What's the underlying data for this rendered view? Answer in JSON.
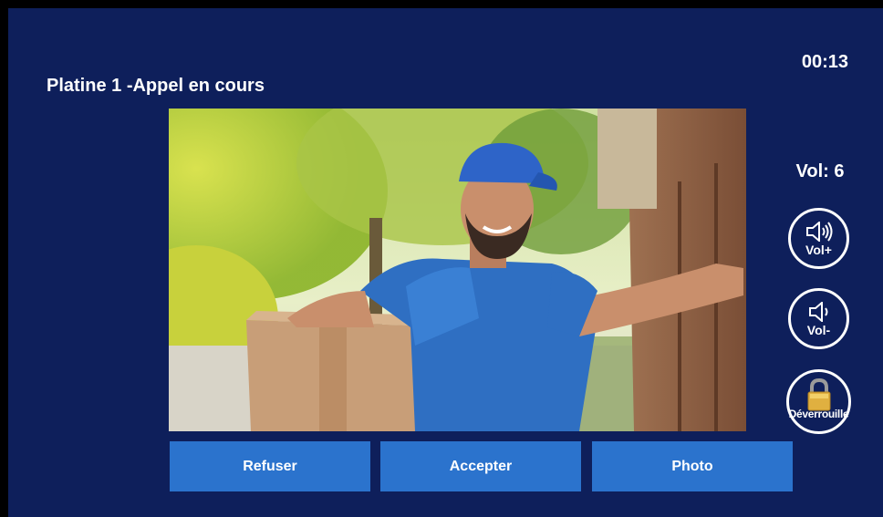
{
  "header": {
    "title": "Platine 1 -Appel en cours",
    "timer": "00:13"
  },
  "video": {
    "feed_description": "camera-feed-delivery-person"
  },
  "volume": {
    "label": "Vol: 6",
    "up_label": "Vol+",
    "down_label": "Vol-",
    "up_icon": "speaker-loud-icon",
    "down_icon": "speaker-quiet-icon"
  },
  "unlock": {
    "label": "Déverrouille",
    "icon": "padlock-icon"
  },
  "actions": {
    "refuse_label": "Refuser",
    "accept_label": "Accepter",
    "photo_label": "Photo"
  },
  "colors": {
    "background": "#0e1f5b",
    "button": "#2b73cd",
    "text": "#ffffff"
  }
}
